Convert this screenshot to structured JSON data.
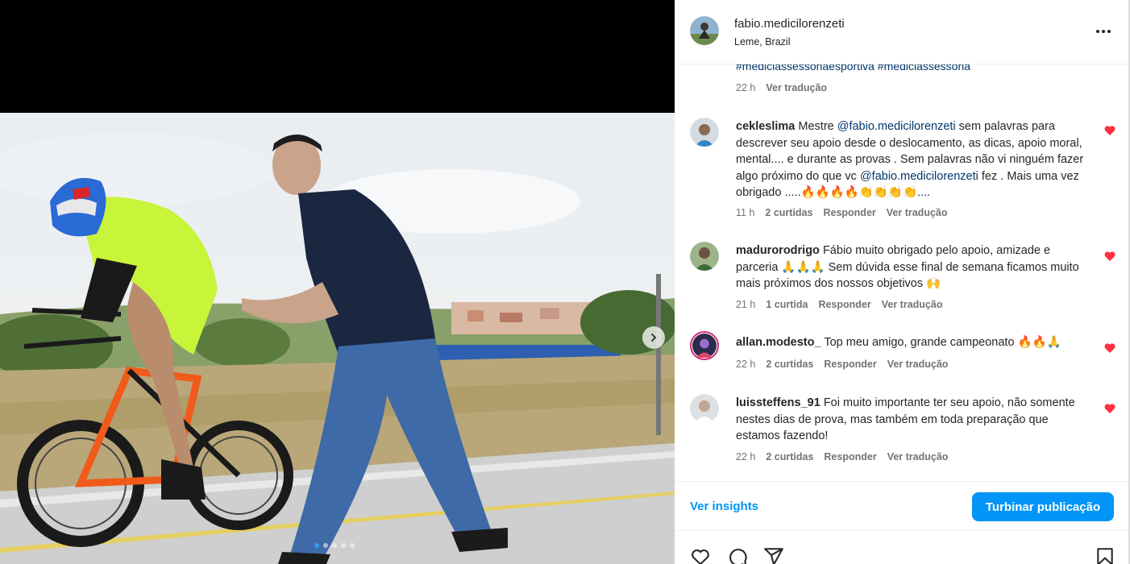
{
  "header": {
    "username": "fabio.medicilorenzeti",
    "location": "Leme, Brazil"
  },
  "caption": {
    "hashtags": "#mediciassessoriaesportiva #mediciassessoria",
    "time": "22 h",
    "translate": "Ver tradução"
  },
  "comments": [
    {
      "user": "cekleslima",
      "parts": [
        "Mestre ",
        "@fabio.medicilorenzeti",
        " sem palavras para descrever seu apoio desde o deslocamento, as dicas, apoio moral, mental.... e durante as provas . Sem palavras não vi ninguém fazer algo próximo do que vc ",
        "@fabio.medicilorenzeti",
        " fez . Mais uma vez obrigado .....🔥🔥🔥🔥👏👏👏👏...."
      ],
      "time": "11 h",
      "likes": "2 curtidas",
      "reply": "Responder",
      "translate": "Ver tradução"
    },
    {
      "user": "madurorodrigo",
      "text": "Fábio muito obrigado pelo apoio, amizade e parceria 🙏🙏🙏 Sem dúvida esse final de semana ficamos muito mais próximos dos nossos objetivos 🙌",
      "time": "21 h",
      "likes": "1 curtida",
      "reply": "Responder",
      "translate": "Ver tradução"
    },
    {
      "user": "allan.modesto_",
      "text": "Top meu amigo, grande campeonato 🔥🔥🙏",
      "time": "22 h",
      "likes": "2 curtidas",
      "reply": "Responder",
      "translate": "Ver tradução"
    },
    {
      "user": "luissteffens_91",
      "text": "Foi muito importante ter seu apoio, não somente nestes dias de prova, mas também em toda preparação que estamos fazendo!",
      "time": "22 h",
      "likes": "2 curtidas",
      "reply": "Responder",
      "translate": "Ver tradução"
    }
  ],
  "footer": {
    "insights": "Ver insights",
    "boost": "Turbinar publicação"
  },
  "media": {
    "carousel_total": 5,
    "carousel_active": 1
  },
  "colors": {
    "link": "#00376b",
    "accent": "#0095f6",
    "heart": "#ff3040",
    "jersey": "#c8f53a"
  },
  "icons": [
    "more-icon",
    "heart-icon",
    "like-icon",
    "comment-icon",
    "share-icon",
    "bookmark-icon",
    "chevron-right-icon"
  ]
}
